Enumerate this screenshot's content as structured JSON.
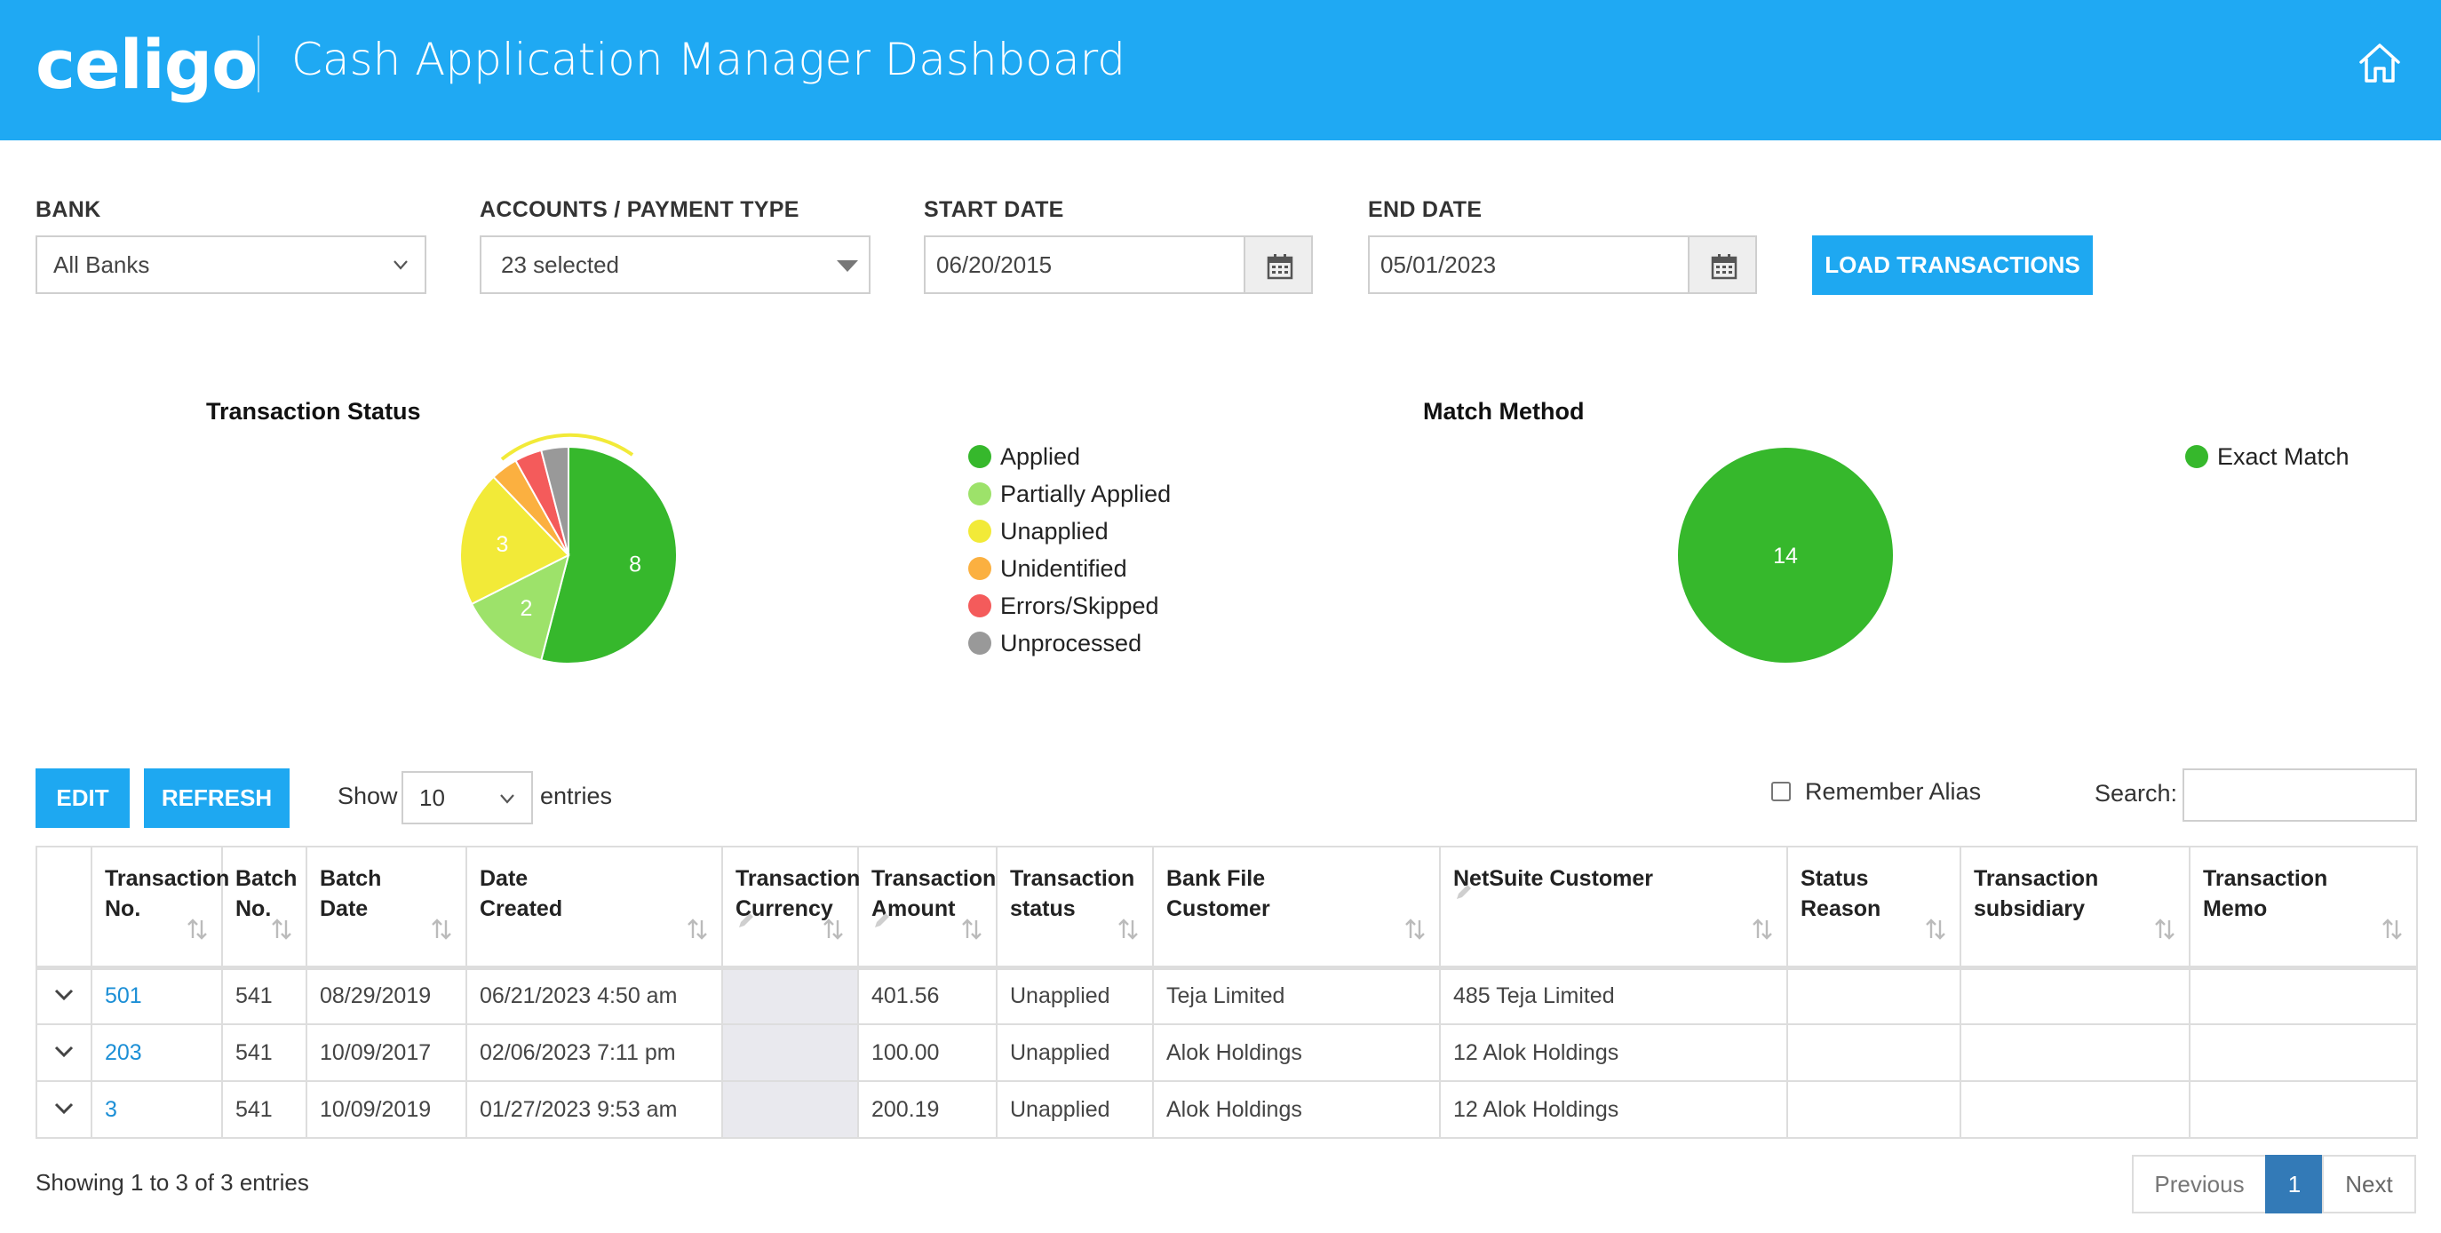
{
  "header": {
    "logo_text": "celigo",
    "title": "Cash Application Manager Dashboard",
    "home_icon": "home-icon"
  },
  "filters": {
    "bank": {
      "label": "BANK",
      "value": "All Banks"
    },
    "accounts": {
      "label": "ACCOUNTS / PAYMENT TYPE",
      "value": "23 selected"
    },
    "start_date": {
      "label": "START DATE",
      "value": "06/20/2015"
    },
    "end_date": {
      "label": "END DATE",
      "value": "05/01/2023"
    },
    "load_button": "LOAD TRANSACTIONS",
    "calendar_icon": "calendar-icon"
  },
  "chart_data": [
    {
      "type": "pie",
      "title": "Transaction Status",
      "slices": [
        {
          "name": "Applied",
          "value": 8,
          "label": "8",
          "color": "#36b82c"
        },
        {
          "name": "Partially Applied",
          "value": 2,
          "label": "2",
          "color": "#9de26a"
        },
        {
          "name": "Unapplied",
          "value": 3,
          "label": "3",
          "color": "#f2ea38"
        },
        {
          "name": "Unidentified",
          "value": 0.6,
          "label": "",
          "color": "#fbb040"
        },
        {
          "name": "Errors/Skipped",
          "value": 0.6,
          "label": "",
          "color": "#f45b5b"
        },
        {
          "name": "Unprocessed",
          "value": 0.6,
          "label": "",
          "color": "#999999"
        }
      ],
      "legend": [
        "Applied",
        "Partially Applied",
        "Unapplied",
        "Unidentified",
        "Errors/Skipped",
        "Unprocessed"
      ],
      "legend_position": "right"
    },
    {
      "type": "pie",
      "title": "Match Method",
      "slices": [
        {
          "name": "Exact Match",
          "value": 14,
          "label": "14",
          "color": "#36b82c"
        }
      ],
      "legend": [
        "Exact Match"
      ],
      "legend_position": "right"
    }
  ],
  "toolbar": {
    "edit_label": "EDIT",
    "refresh_label": "REFRESH",
    "show_label": "Show",
    "entries_value": "10",
    "entries_label": "entries",
    "remember_alias_label": "Remember Alias",
    "search_label": "Search:",
    "search_value": ""
  },
  "table": {
    "columns": [
      {
        "line1": "",
        "line2": ""
      },
      {
        "line1": "Transaction",
        "line2": "No."
      },
      {
        "line1": "Batch",
        "line2": "No."
      },
      {
        "line1": "Batch",
        "line2": "Date"
      },
      {
        "line1": "Date",
        "line2": "Created"
      },
      {
        "line1": "Transaction",
        "line2": "Currency"
      },
      {
        "line1": "Transaction",
        "line2": "Amount"
      },
      {
        "line1": "Transaction",
        "line2": "status"
      },
      {
        "line1": "Bank File",
        "line2": "Customer"
      },
      {
        "line1": "NetSuite Customer",
        "line2": ""
      },
      {
        "line1": "Status",
        "line2": "Reason"
      },
      {
        "line1": "Transaction",
        "line2": "subsidiary"
      },
      {
        "line1": "Transaction",
        "line2": "Memo"
      }
    ],
    "rows": [
      {
        "txn_no": "501",
        "batch_no": "541",
        "batch_date": "08/29/2019",
        "date_created": "06/21/2023 4:50 am",
        "currency": "",
        "amount": "401.56",
        "status": "Unapplied",
        "bank_customer": "Teja Limited",
        "netsuite_customer": "485 Teja Limited",
        "status_reason": "",
        "subsidiary": "",
        "memo": ""
      },
      {
        "txn_no": "203",
        "batch_no": "541",
        "batch_date": "10/09/2017",
        "date_created": "02/06/2023 7:11 pm",
        "currency": "",
        "amount": "100.00",
        "status": "Unapplied",
        "bank_customer": "Alok Holdings",
        "netsuite_customer": "12 Alok Holdings",
        "status_reason": "",
        "subsidiary": "",
        "memo": ""
      },
      {
        "txn_no": "3",
        "batch_no": "541",
        "batch_date": "10/09/2019",
        "date_created": "01/27/2023 9:53 am",
        "currency": "",
        "amount": "200.19",
        "status": "Unapplied",
        "bank_customer": "Alok Holdings",
        "netsuite_customer": "12 Alok Holdings",
        "status_reason": "",
        "subsidiary": "",
        "memo": ""
      }
    ]
  },
  "footer": {
    "showing_text": "Showing 1 to 3 of 3 entries",
    "previous": "Previous",
    "current_page": "1",
    "next": "Next"
  },
  "colors": {
    "header_bg": "#1fa9f3",
    "button_bg": "#1ea8f1",
    "link": "#1c8fd6",
    "active_page": "#337ab7"
  }
}
